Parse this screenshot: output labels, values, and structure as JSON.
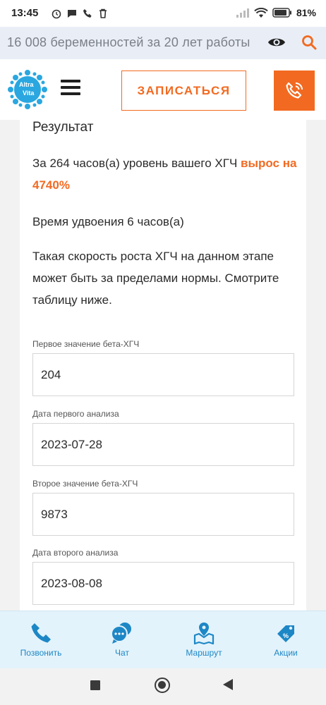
{
  "status_bar": {
    "time": "13:45",
    "battery": "81%"
  },
  "search_strip": {
    "text": "16 008 беременностей за 20 лет работы"
  },
  "header": {
    "logo_line1": "Altra",
    "logo_line2": "Vita",
    "signup_label": "ЗАПИСАТЬСЯ",
    "accent_color": "#f26a21"
  },
  "result": {
    "title": "Результат",
    "line1_prefix": "За 264 часов(а) уровень вашего ХГЧ ",
    "line1_accent": "вырос на 4740%",
    "doubling": "Время удвоения 6 часов(а)",
    "note": "Такая скорость роста ХГЧ на данном этапе может быть за пределами нормы. Смотрите таблицу ниже."
  },
  "form": {
    "fields": [
      {
        "label": "Первое значение бета-ХГЧ",
        "value": "204"
      },
      {
        "label": "Дата первого анализа",
        "value": "2023-07-28"
      },
      {
        "label": "Второе значение бета-ХГЧ",
        "value": "9873"
      },
      {
        "label": "Дата второго анализа",
        "value": "2023-08-08"
      }
    ]
  },
  "bottom_bar": {
    "items": [
      {
        "label": "Позвонить",
        "icon": "phone-icon"
      },
      {
        "label": "Чат",
        "icon": "chat-icon"
      },
      {
        "label": "Маршрут",
        "icon": "map-route-icon"
      },
      {
        "label": "Акции",
        "icon": "discount-tag-icon"
      }
    ],
    "color": "#1d87c6"
  }
}
